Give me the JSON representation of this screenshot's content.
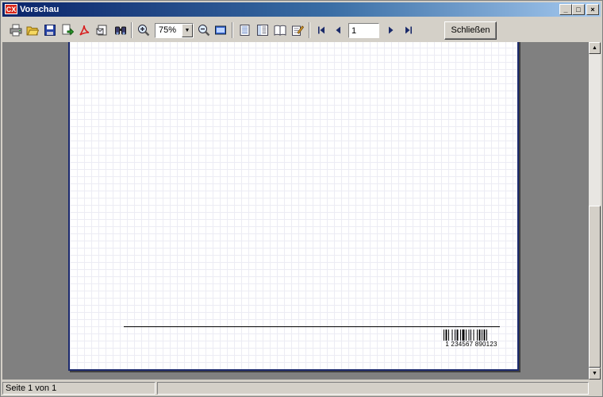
{
  "window": {
    "title": "Vorschau",
    "app_icon_text": "CX",
    "controls": {
      "minimize": "_",
      "maximize": "□",
      "close": "×"
    }
  },
  "toolbar": {
    "buttons": [
      {
        "icon": "print-icon"
      },
      {
        "icon": "open-folder-icon"
      },
      {
        "icon": "save-icon"
      },
      {
        "icon": "export-icon"
      },
      {
        "icon": "pdf-icon"
      },
      {
        "icon": "email-icon"
      },
      {
        "icon": "find-icon"
      },
      {
        "icon": "zoom-in-icon"
      },
      {
        "icon": "zoom-out-icon"
      },
      {
        "icon": "full-screen-icon"
      },
      {
        "icon": "outline-icon"
      },
      {
        "icon": "thumbnails-icon"
      },
      {
        "icon": "page-setup-icon"
      },
      {
        "icon": "edit-icon"
      },
      {
        "icon": "first-page-icon"
      },
      {
        "icon": "previous-page-icon"
      },
      {
        "icon": "next-page-icon"
      },
      {
        "icon": "last-page-icon"
      }
    ],
    "zoom": {
      "value": "75%"
    },
    "page_number": "1",
    "close_label": "Schließen"
  },
  "page": {
    "barcode_text": "1 234567 890123"
  },
  "status": {
    "page_info": "Seite 1 von 1",
    "extra": ""
  },
  "colors": {
    "title_start": "#0a246a",
    "title_end": "#a6caf0",
    "page_border": "#1c2a6e",
    "workspace": "#808080"
  }
}
